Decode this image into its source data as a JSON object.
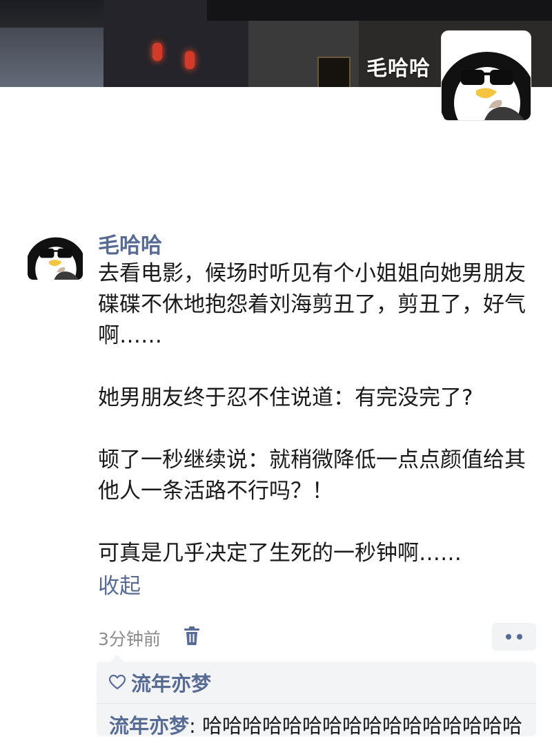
{
  "cover": {
    "username": "毛哈哈"
  },
  "post": {
    "author": "毛哈哈",
    "paragraphs": [
      "去看电影，候场时听见有个小姐姐向她男朋友碟碟不休地抱怨着刘海剪丑了，剪丑了，好气啊……",
      "她男朋友终于忍不住说道：有完没完了?",
      "顿了一秒继续说：就稍微降低一点点颜值给其他人一条活路不行吗？！",
      "可真是几乎决定了生死的一秒钟啊……"
    ],
    "collapse_label": "收起",
    "time": "3分钟前"
  },
  "comments": {
    "likes": "流年亦梦",
    "items": [
      {
        "author": "流年亦梦",
        "separator": ": ",
        "text": "哈哈哈哈哈哈哈哈哈哈哈哈哈哈哈哈"
      }
    ]
  },
  "icons": {
    "trash": "trash-icon",
    "more": "more-dots-icon",
    "heart": "heart-outline-icon"
  },
  "colors": {
    "link": "#576b95",
    "time": "#8c8c8c",
    "comment_bg": "#f3f4f6"
  }
}
